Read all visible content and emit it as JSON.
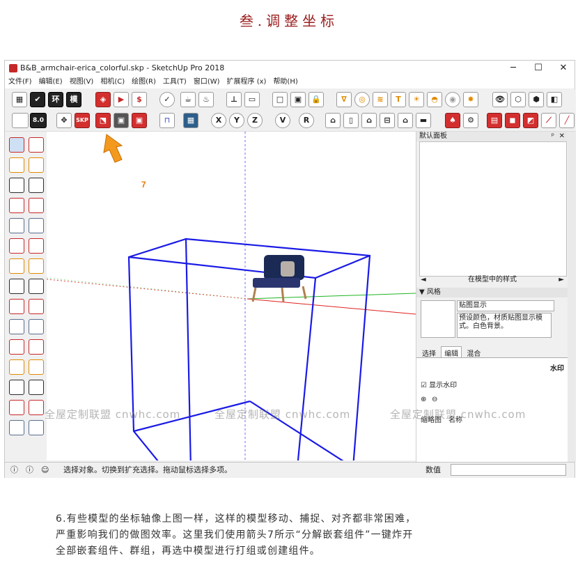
{
  "heading": "叁.调整坐标",
  "window": {
    "title": "B&B_armchair-erica_colorful.skp - SketchUp Pro 2018",
    "controls": {
      "minimize": "─",
      "maximize": "☐",
      "close": "✕"
    }
  },
  "menu": [
    "文件(F)",
    "编辑(E)",
    "视图(V)",
    "相机(C)",
    "绘图(R)",
    "工具(T)",
    "窗口(W)",
    "扩展程序 (x)",
    "帮助(H)"
  ],
  "toolbar2": {
    "version_badge": "8.0",
    "skp_label": "SKP",
    "axis_x": "X",
    "axis_y": "Y",
    "axis_z": "Z",
    "axis_v": "V",
    "axis_r": "R"
  },
  "annotation": {
    "arrow_number": "7"
  },
  "panel": {
    "title": "默认面板",
    "pin": "ᵖ",
    "close": "✕",
    "styles_in_model": "在模型中的样式",
    "style_section": "风格",
    "style_name": "贴图显示",
    "style_desc": "预设颜色，材质贴图显示模式。白色背景。",
    "tabs": [
      "选择",
      "编辑",
      "混合"
    ],
    "active_tab": "编辑",
    "watermark_label": "水印",
    "show_watermark": "显示水印",
    "col_thumb": "缩略图",
    "col_name": "名称"
  },
  "status": {
    "message": "选择对象。切换到扩充选择。拖动鼠标选择多项。",
    "value_label": "数值",
    "value": ""
  },
  "watermark_text": "全屋定制联盟 cnwhc.com",
  "caption": {
    "line1": "6.有些模型的坐标轴像上图一样，这样的模型移动、捕捉、对齐都非常困难，",
    "line2": "严重影响我们的做图效率。这里我们使用箭头7所示“分解嵌套组件”一键炸开",
    "line3": "全部嵌套组件、群组，再选中模型进行打组或创建组件。"
  },
  "colors": {
    "accent_red": "#d32f2f",
    "box_blue": "#1a1ae6",
    "axis_red": "#e02020",
    "axis_green": "#1fb41f",
    "axis_blue": "#4a4af0",
    "arrow_orange": "#f39a1e"
  }
}
